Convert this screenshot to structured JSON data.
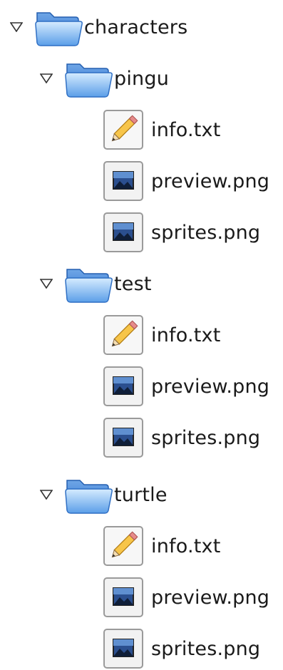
{
  "tree": {
    "root": {
      "label": "characters",
      "expanded": true,
      "icon": "folder-open-icon",
      "children": [
        {
          "label": "pingu",
          "expanded": true,
          "icon": "folder-open-icon",
          "files": [
            {
              "label": "info.txt",
              "icon": "text-file-pencil-icon"
            },
            {
              "label": "preview.png",
              "icon": "image-file-icon"
            },
            {
              "label": "sprites.png",
              "icon": "image-file-icon"
            }
          ]
        },
        {
          "label": "test",
          "expanded": true,
          "icon": "folder-open-icon",
          "files": [
            {
              "label": "info.txt",
              "icon": "text-file-pencil-icon"
            },
            {
              "label": "preview.png",
              "icon": "image-file-icon"
            },
            {
              "label": "sprites.png",
              "icon": "image-file-icon"
            }
          ]
        },
        {
          "label": "turtle",
          "expanded": true,
          "icon": "folder-open-icon",
          "files": [
            {
              "label": "info.txt",
              "icon": "text-file-pencil-icon"
            },
            {
              "label": "preview.png",
              "icon": "image-file-icon"
            },
            {
              "label": "sprites.png",
              "icon": "image-file-icon"
            }
          ]
        }
      ]
    }
  },
  "colors": {
    "folder_light": "#9fcaf5",
    "folder_dark": "#2a74d6",
    "text": "#1a1a1a",
    "expander": "#333333"
  }
}
